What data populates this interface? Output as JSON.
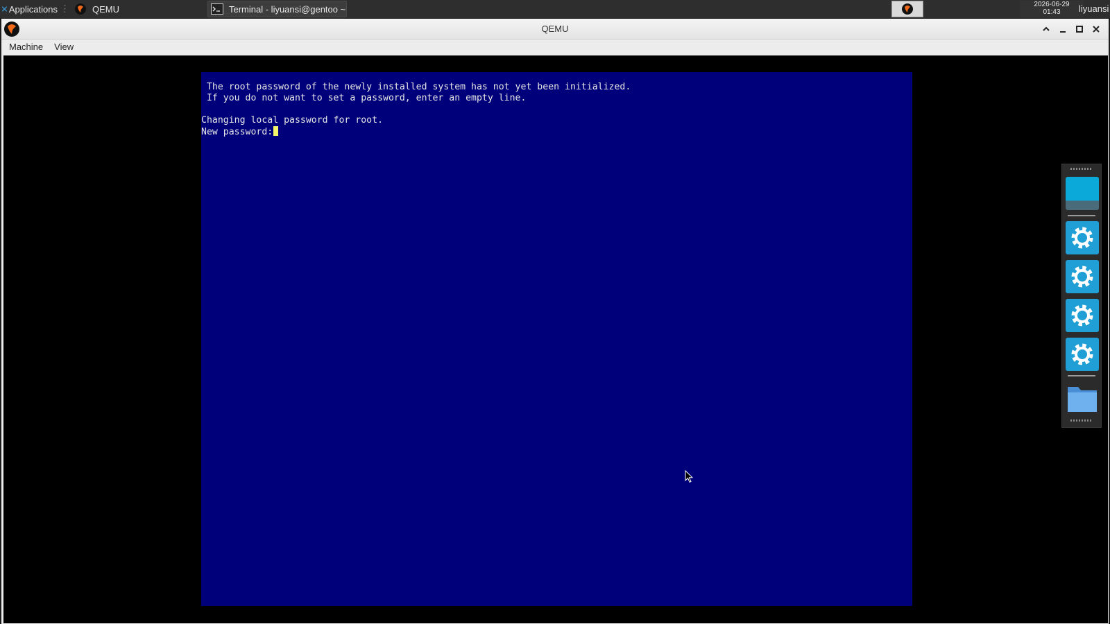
{
  "taskbar": {
    "applications_label": "Applications",
    "tasks": [
      {
        "label": "QEMU"
      },
      {
        "label": "Terminal - liyuansi@gentoo ~"
      }
    ],
    "clock_date": "2026-06-29",
    "clock_time": "01:43",
    "username": "liyuansi"
  },
  "window": {
    "title": "QEMU",
    "menu": [
      "Machine",
      "View"
    ]
  },
  "console": {
    "lines": [
      " The root password of the newly installed system has not yet been initialized.",
      " If you do not want to set a password, enter an empty line.",
      "",
      "Changing local password for root.",
      "New password:"
    ],
    "background": "#00007a",
    "cursor_color": "#f5f56a"
  },
  "dock": {
    "items": [
      "desktop-tile",
      "gear-icon",
      "gear-icon",
      "gear-icon",
      "gear-icon",
      "folder-icon"
    ]
  }
}
